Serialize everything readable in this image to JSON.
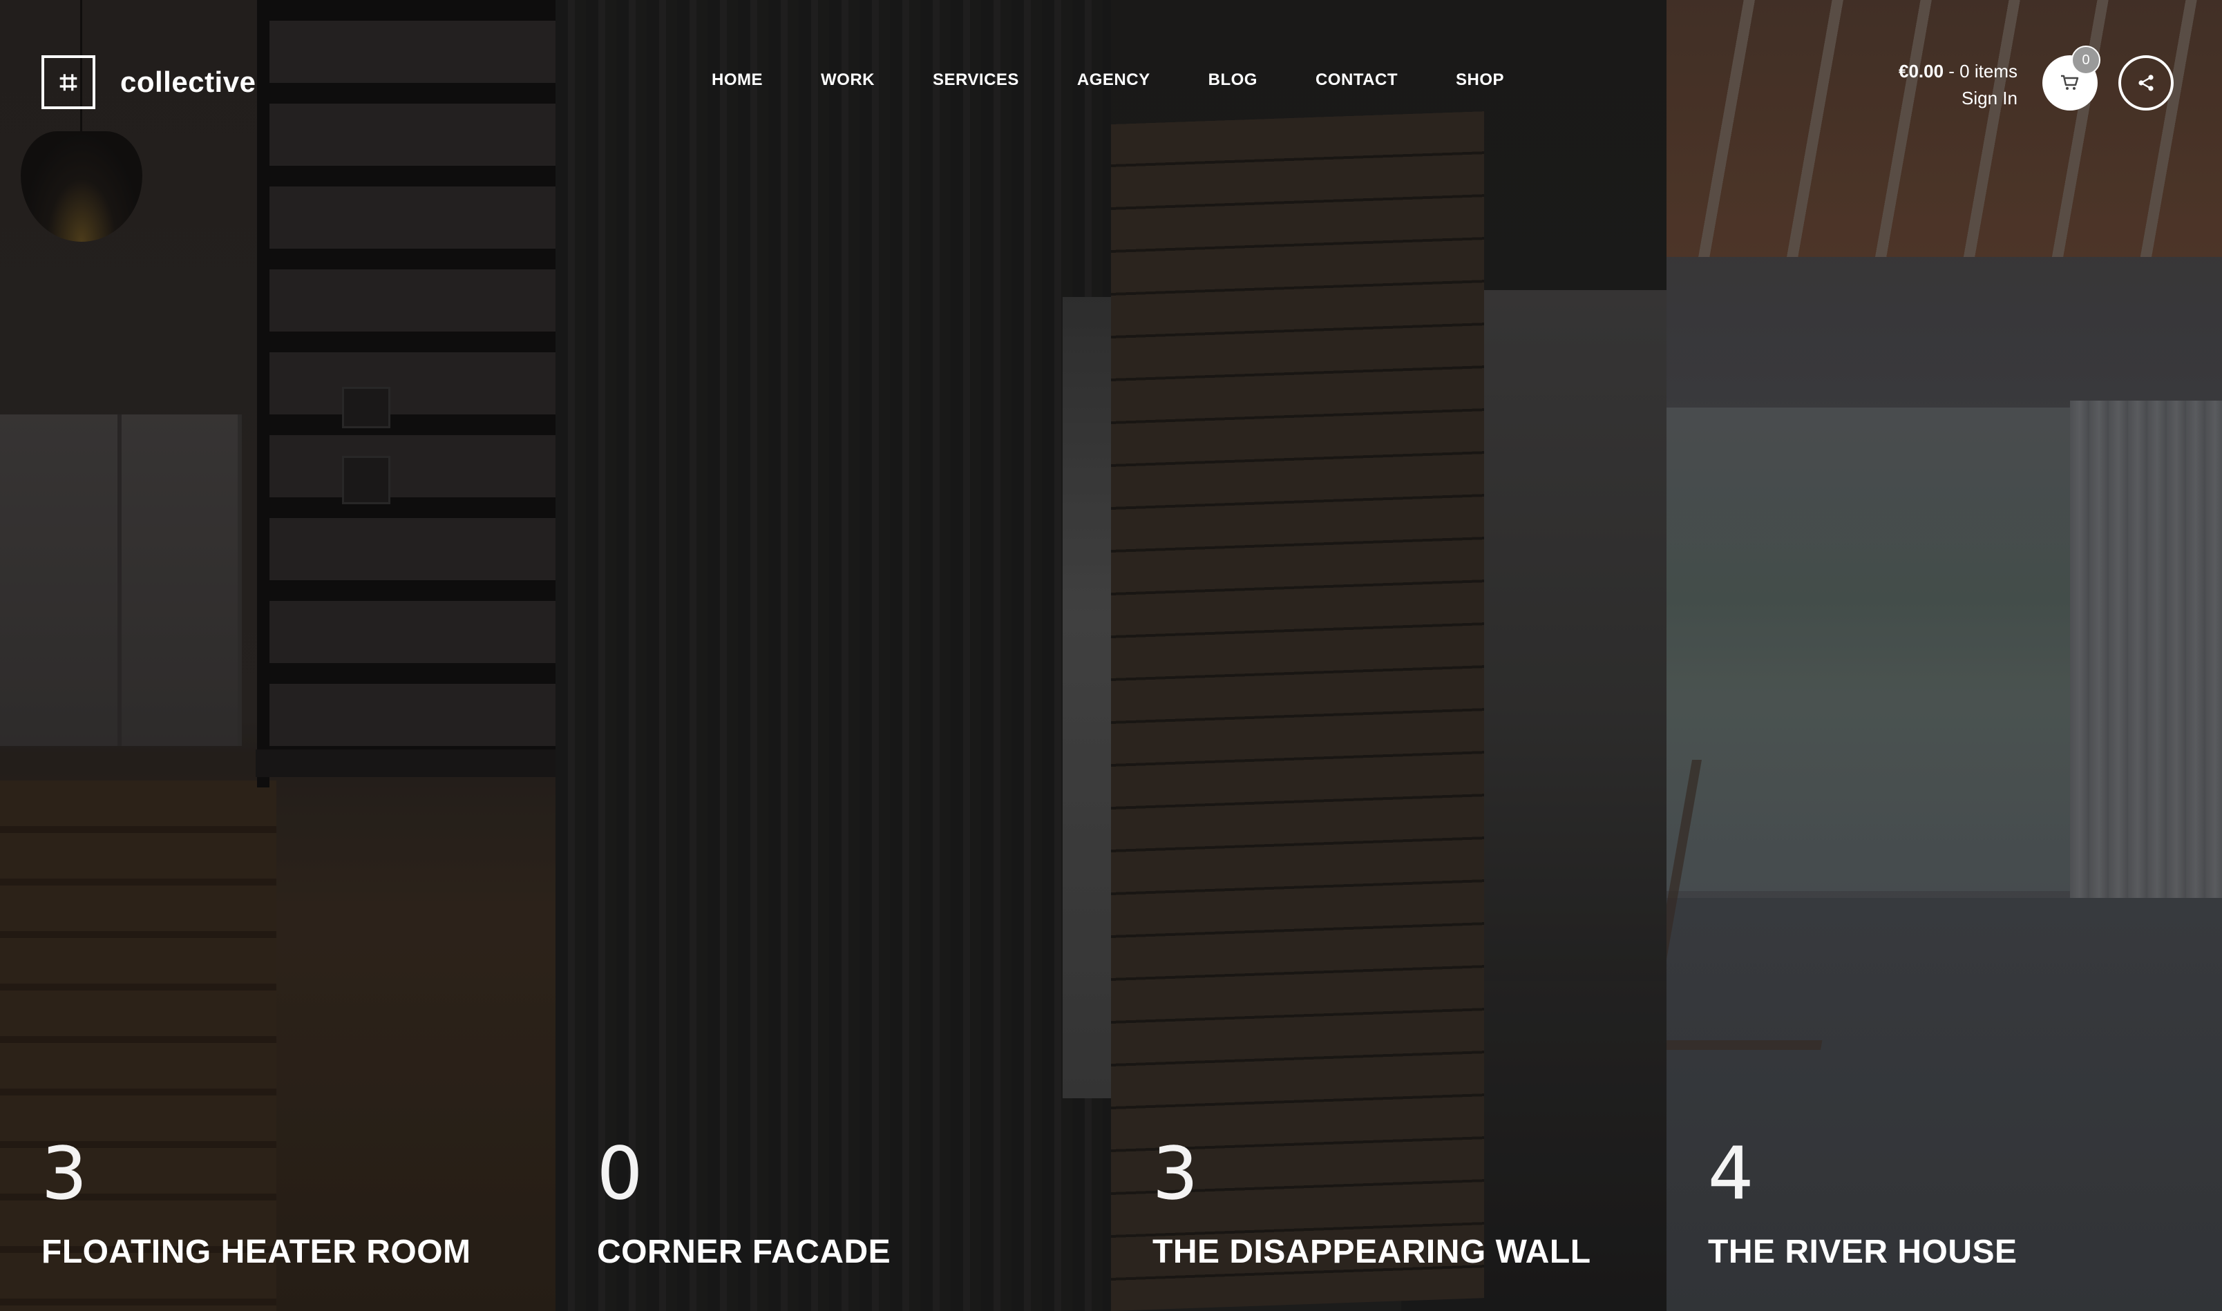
{
  "brand": {
    "logo_glyph": "⌗",
    "name": "collective"
  },
  "nav": [
    {
      "label": "HOME"
    },
    {
      "label": "WORK"
    },
    {
      "label": "SERVICES"
    },
    {
      "label": "AGENCY"
    },
    {
      "label": "BLOG"
    },
    {
      "label": "CONTACT"
    },
    {
      "label": "SHOP"
    }
  ],
  "account": {
    "cart_total": "€0.00",
    "cart_items": " - 0 items",
    "sign_in": "Sign In"
  },
  "cart": {
    "badge_count": "0",
    "icon": "cart-icon"
  },
  "share": {
    "icon": "share-icon"
  },
  "panels": [
    {
      "number": "3",
      "title": "FLOATING HEATER ROOM"
    },
    {
      "number": "0",
      "title": "CORNER FACADE"
    },
    {
      "number": "3",
      "title": "THE DISAPPEARING WALL"
    },
    {
      "number": "4",
      "title": "THE RIVER HOUSE"
    }
  ],
  "colors": {
    "text": "#ffffff",
    "badge": "#9a9a9a"
  }
}
